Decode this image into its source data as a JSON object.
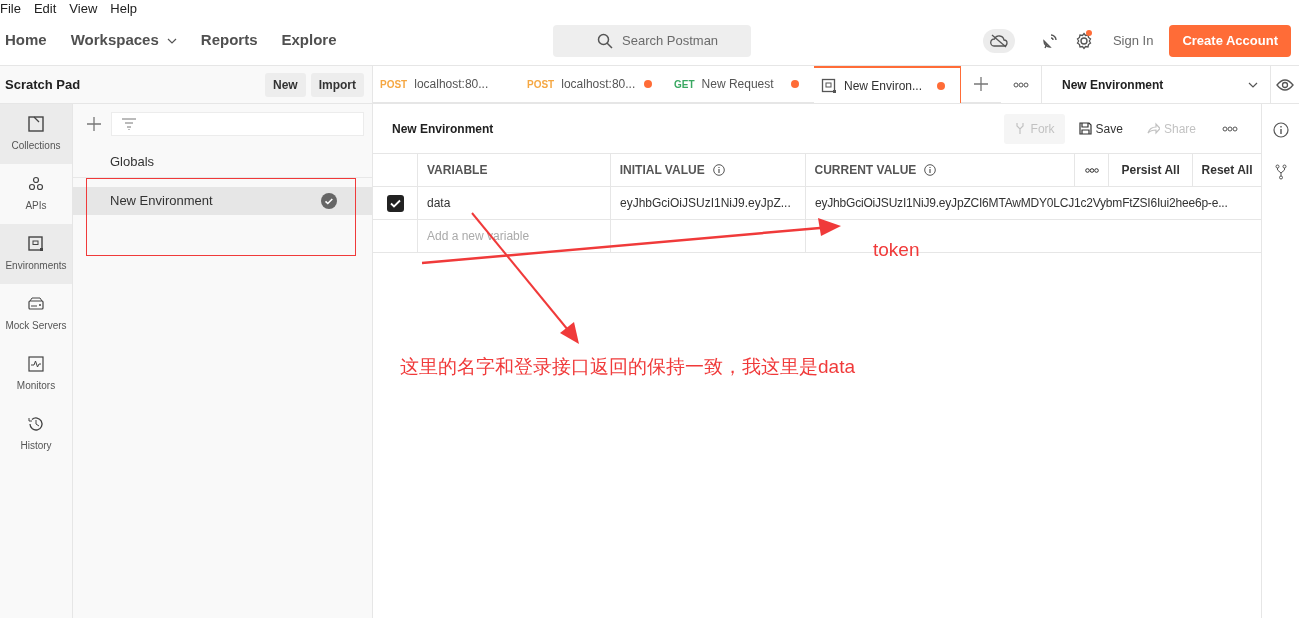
{
  "menu": [
    "File",
    "Edit",
    "View",
    "Help"
  ],
  "nav": [
    {
      "label": "Home",
      "dropdown": false
    },
    {
      "label": "Workspaces",
      "dropdown": true
    },
    {
      "label": "Reports",
      "dropdown": false
    },
    {
      "label": "Explore",
      "dropdown": false
    }
  ],
  "search": {
    "placeholder": "Search Postman"
  },
  "header": {
    "settings_badge": true,
    "sign_in": "Sign In",
    "create_account": "Create Account"
  },
  "scratch_pad": {
    "title": "Scratch Pad",
    "buttons": [
      "New",
      "Import"
    ]
  },
  "tabs": [
    {
      "kind": "request",
      "method": "POST",
      "color": "#f5a742",
      "label": "localhost:80...",
      "unsaved": false,
      "selected": false
    },
    {
      "kind": "request",
      "method": "POST",
      "color": "#f5a742",
      "label": "localhost:80...",
      "unsaved": true,
      "selected": false
    },
    {
      "kind": "request",
      "method": "GET",
      "color": "#3aa862",
      "label": "New Request",
      "unsaved": true,
      "selected": false
    },
    {
      "kind": "environment",
      "label": "New Environ...",
      "unsaved": true,
      "selected": true
    }
  ],
  "environment_selector": "New Environment",
  "rail": [
    {
      "label": "Collections",
      "selected": true
    },
    {
      "label": "APIs",
      "selected": false
    },
    {
      "label": "Environments",
      "selected": true
    },
    {
      "label": "Mock Servers",
      "selected": false
    },
    {
      "label": "Monitors",
      "selected": false
    },
    {
      "label": "History",
      "selected": false
    }
  ],
  "environments": [
    {
      "label": "Globals",
      "selected": false,
      "active": false
    },
    {
      "label": "New Environment",
      "selected": true,
      "active": true
    }
  ],
  "editor": {
    "title": "New Environment",
    "actions": [
      {
        "label": "Fork",
        "disabled": true
      },
      {
        "label": "Save",
        "disabled": false
      },
      {
        "label": "Share",
        "disabled": true
      }
    ],
    "columns": [
      "VARIABLE",
      "INITIAL VALUE",
      "CURRENT VALUE"
    ],
    "table_actions": [
      "Persist All",
      "Reset All"
    ],
    "rows": [
      {
        "checked": true,
        "variable": "data",
        "initial_value": "eyJhbGciOiJSUzI1NiJ9.eyJpZ...",
        "current_value": "eyJhbGciOiJSUzI1NiJ9.eyJpZCI6MTAwMDY0LCJ1c2VybmFtZSI6Iui2hee6p-e..."
      }
    ],
    "new_row": {
      "placeholder": "Add a new variable"
    }
  },
  "annotations": [
    {
      "kind": "label",
      "text": "token"
    },
    {
      "kind": "label",
      "text": "这里的名字和登录接口返回的保持一致，我这里是data"
    }
  ]
}
